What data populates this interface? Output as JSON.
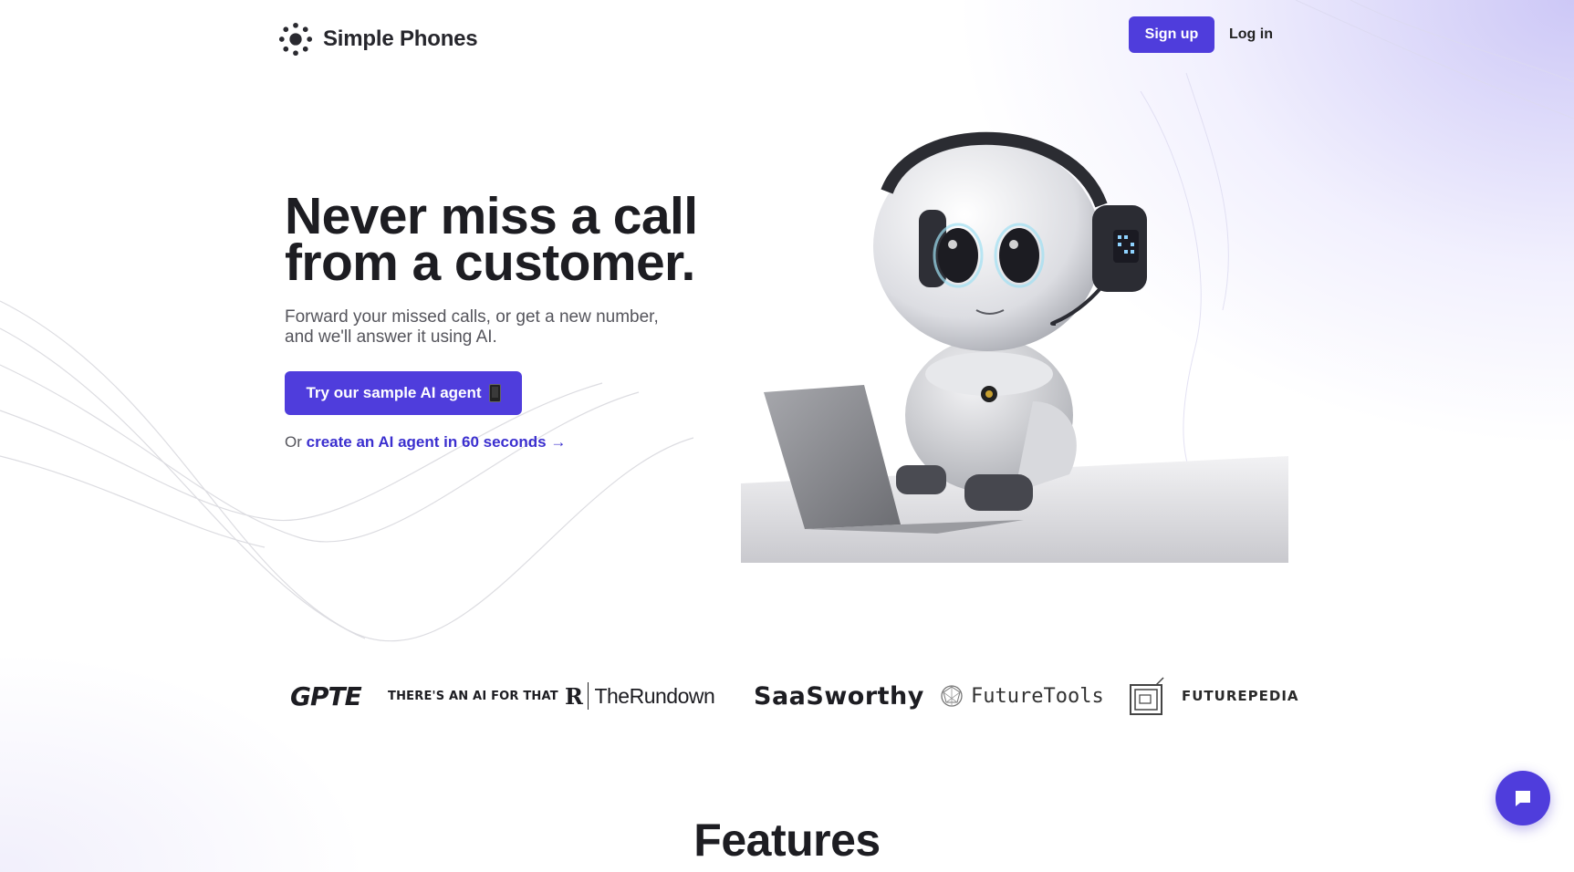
{
  "brand": {
    "name": "Simple Phones",
    "accent_color": "#4f3ddc",
    "link_color": "#3b2fcf"
  },
  "header": {
    "logo_icon": "sun-burst-icon",
    "signup_label": "Sign up",
    "login_label": "Log in"
  },
  "hero": {
    "title_line1": "Never miss a call",
    "title_line2": "from a customer.",
    "subtitle_line1": "Forward your missed calls, or get a new number,",
    "subtitle_line2": "and we'll answer it using AI.",
    "cta_label": "Try our sample AI agent",
    "cta_icon": "mobile-phone-icon",
    "secondary_prefix": "Or",
    "secondary_link": "create an AI agent in 60 seconds →",
    "illustration": "robot-with-headset-at-laptop"
  },
  "press_logos": [
    {
      "name": "GPTE",
      "text": "GPTE"
    },
    {
      "name": "There's An AI For That",
      "text": "THERE'S AN AI FOR THAT"
    },
    {
      "name": "The Rundown",
      "text": "TheRundown"
    },
    {
      "name": "SaaSworthy",
      "text": "SaaSworthy"
    },
    {
      "name": "FutureTools",
      "text": "FutureTools"
    },
    {
      "name": "Futurepedia",
      "text": "FUTUREPEDIA"
    }
  ],
  "features": {
    "heading": "Features"
  },
  "chat_widget": {
    "icon": "chat-bubble-icon"
  }
}
